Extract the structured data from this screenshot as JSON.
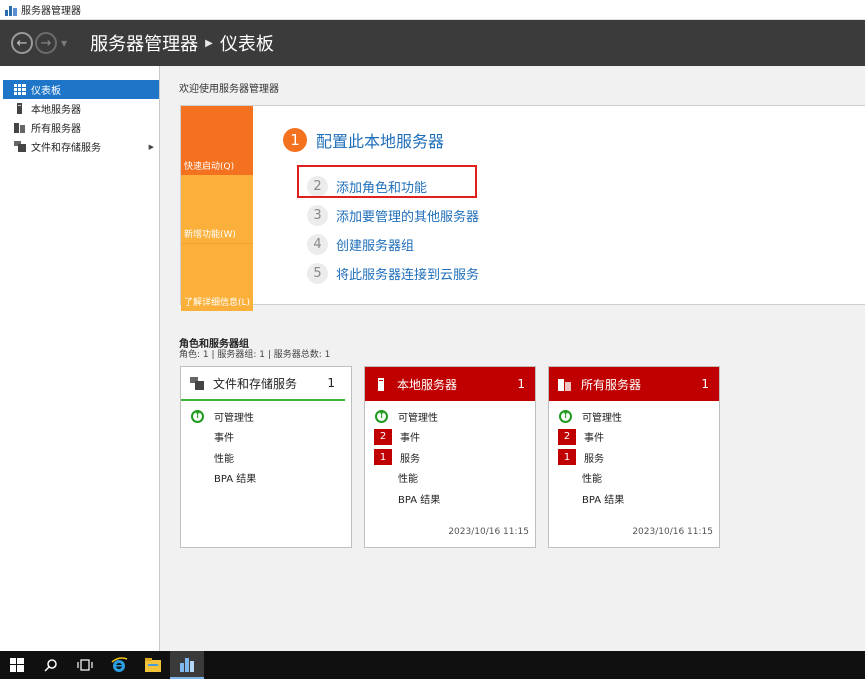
{
  "window": {
    "title": "服务器管理器"
  },
  "header": {
    "breadcrumb": [
      "服务器管理器",
      "仪表板"
    ]
  },
  "sidebar": {
    "items": [
      {
        "label": "仪表板",
        "active": true
      },
      {
        "label": "本地服务器"
      },
      {
        "label": "所有服务器"
      },
      {
        "label": "文件和存储服务",
        "expandable": true
      }
    ]
  },
  "welcome": {
    "title": "欢迎使用服务器管理器",
    "quickstart_tabs": [
      "快速启动(Q)",
      "新增功能(W)",
      "了解详细信息(L)"
    ],
    "steps": [
      {
        "num": "1",
        "label": "配置此本地服务器"
      },
      {
        "num": "2",
        "label": "添加角色和功能"
      },
      {
        "num": "3",
        "label": "添加要管理的其他服务器"
      },
      {
        "num": "4",
        "label": "创建服务器组"
      },
      {
        "num": "5",
        "label": "将此服务器连接到云服务"
      }
    ]
  },
  "roles": {
    "title": "角色和服务器组",
    "summary": "角色: 1 | 服务器组: 1 | 服务器总数: 1",
    "tiles": [
      {
        "name": "文件和存储服务",
        "count": "1",
        "time": "",
        "rows": [
          {
            "status": "ok",
            "label": "可管理性"
          },
          {
            "status": "",
            "label": "事件"
          },
          {
            "status": "",
            "label": "性能"
          },
          {
            "status": "",
            "label": "BPA 结果"
          }
        ]
      },
      {
        "name": "本地服务器",
        "count": "1",
        "time": "2023/10/16 11:15",
        "rows": [
          {
            "status": "ok",
            "label": "可管理性"
          },
          {
            "status": "2",
            "label": "事件"
          },
          {
            "status": "1",
            "label": "服务"
          },
          {
            "status": "",
            "label": "性能"
          },
          {
            "status": "",
            "label": "BPA 结果"
          }
        ]
      },
      {
        "name": "所有服务器",
        "count": "1",
        "time": "2023/10/16 11:15",
        "rows": [
          {
            "status": "ok",
            "label": "可管理性"
          },
          {
            "status": "2",
            "label": "事件"
          },
          {
            "status": "1",
            "label": "服务"
          },
          {
            "status": "",
            "label": "性能"
          },
          {
            "status": "",
            "label": "BPA 结果"
          }
        ]
      }
    ]
  },
  "colors": {
    "accent": "#1f76c9",
    "alert": "#c00000",
    "quickstart": "#f4711f",
    "ok": "#1e9b1e",
    "highlight": "#e0201c"
  },
  "taskbar": {
    "icons": [
      "windows-start-icon",
      "search-icon",
      "task-view-icon",
      "ie-browser-icon",
      "file-explorer-icon",
      "server-manager-icon"
    ]
  }
}
